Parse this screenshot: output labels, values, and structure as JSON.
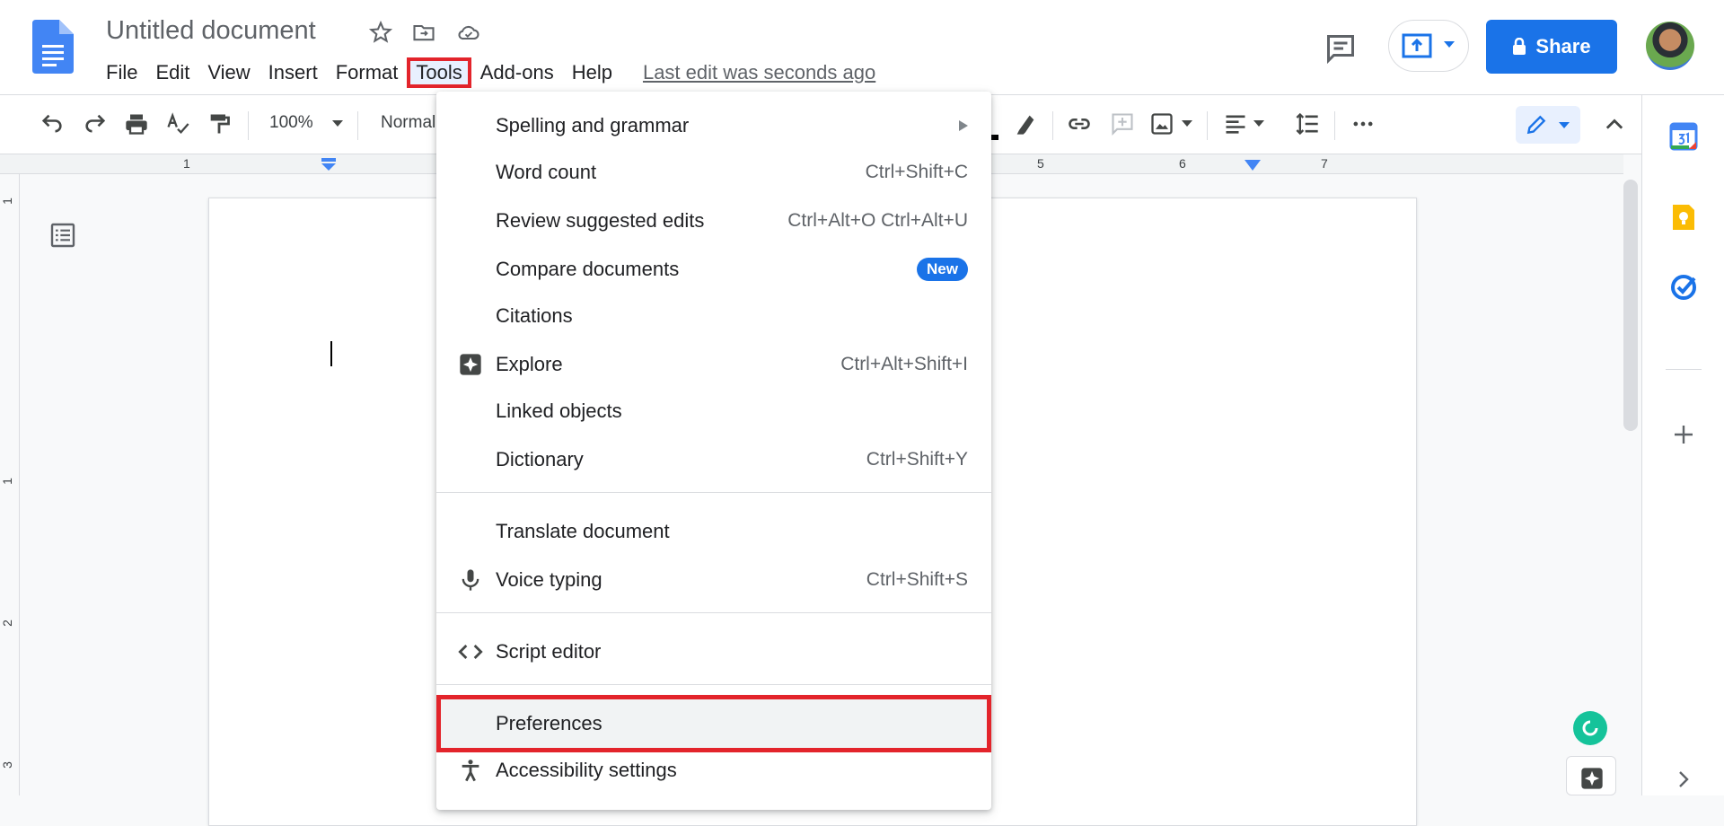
{
  "header": {
    "title": "Untitled document",
    "last_edit": "Last edit was seconds ago",
    "share_label": "Share",
    "menus": [
      "File",
      "Edit",
      "View",
      "Insert",
      "Format",
      "Tools",
      "Add-ons",
      "Help"
    ]
  },
  "toolbar": {
    "zoom": "100%",
    "style": "Normal"
  },
  "ruler": {
    "h_numbers": [
      "1",
      "5",
      "6",
      "7"
    ],
    "v_numbers": [
      "1",
      "1",
      "2",
      "3"
    ]
  },
  "tools_menu": {
    "items": [
      {
        "label": "Spelling and grammar",
        "shortcut": "",
        "submenu": true
      },
      {
        "label": "Word count",
        "shortcut": "Ctrl+Shift+C"
      },
      {
        "label": "Review suggested edits",
        "shortcut": "Ctrl+Alt+O Ctrl+Alt+U"
      },
      {
        "label": "Compare documents",
        "badge": "New"
      },
      {
        "label": "Citations",
        "shortcut": ""
      },
      {
        "label": "Explore",
        "shortcut": "Ctrl+Alt+Shift+I",
        "icon": "explore-icon"
      },
      {
        "label": "Linked objects",
        "shortcut": ""
      },
      {
        "label": "Dictionary",
        "shortcut": "Ctrl+Shift+Y"
      },
      {
        "label": "Translate document",
        "shortcut": ""
      },
      {
        "label": "Voice typing",
        "shortcut": "Ctrl+Shift+S",
        "icon": "microphone-icon"
      },
      {
        "label": "Script editor",
        "shortcut": "",
        "icon": "code-icon"
      },
      {
        "label": "Preferences",
        "shortcut": ""
      },
      {
        "label": "Accessibility settings",
        "shortcut": "",
        "icon": "accessibility-icon"
      }
    ]
  },
  "colors": {
    "accent": "#1a73e8",
    "highlight_box": "#e3242b"
  }
}
